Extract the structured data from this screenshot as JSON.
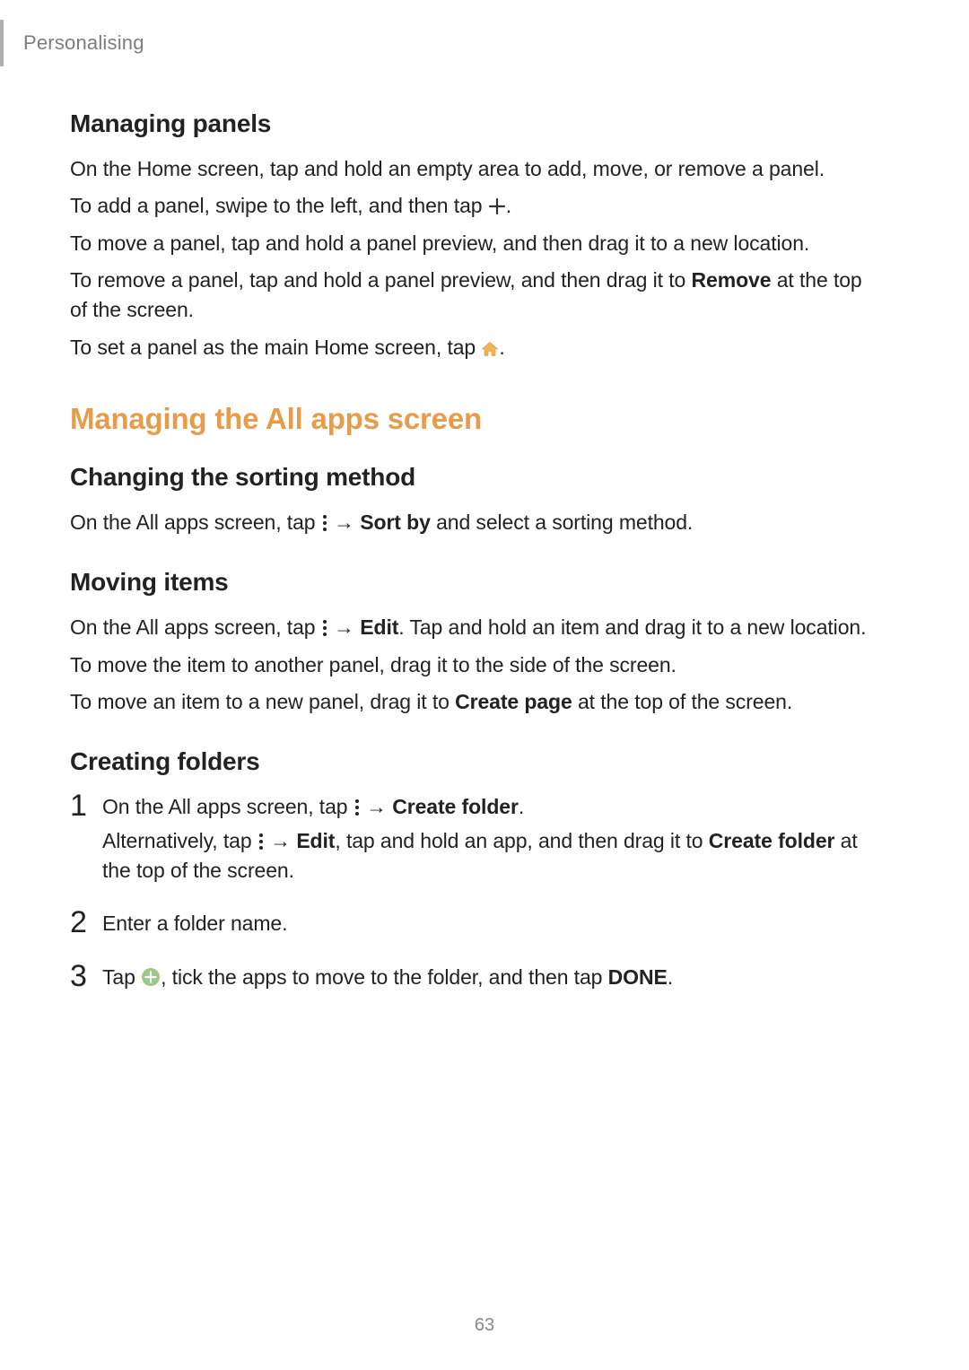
{
  "header": {
    "breadcrumb": "Personalising"
  },
  "s1": {
    "title": "Managing panels",
    "p1": "On the Home screen, tap and hold an empty area to add, move, or remove a panel.",
    "p2a": "To add a panel, swipe to the left, and then tap ",
    "p2b": ".",
    "p3": "To move a panel, tap and hold a panel preview, and then drag it to a new location.",
    "p4a": "To remove a panel, tap and hold a panel preview, and then drag it to ",
    "p4_bold": "Remove",
    "p4b": " at the top of the screen.",
    "p5a": "To set a panel as the main Home screen, tap ",
    "p5b": "."
  },
  "s2": {
    "title": "Managing the All apps screen",
    "sub1": {
      "title": "Changing the sorting method",
      "p1a": "On the All apps screen, tap ",
      "arrow": " → ",
      "p1_bold": "Sort by",
      "p1b": " and select a sorting method."
    },
    "sub2": {
      "title": "Moving items",
      "p1a": "On the All apps screen, tap ",
      "arrow": " → ",
      "p1_bold": "Edit",
      "p1b": ". Tap and hold an item and drag it to a new location.",
      "p2": "To move the item to another panel, drag it to the side of the screen.",
      "p3a": "To move an item to a new panel, drag it to ",
      "p3_bold": "Create page",
      "p3b": " at the top of the screen."
    },
    "sub3": {
      "title": "Creating folders",
      "step1": {
        "num": "1",
        "p1a": "On the All apps screen, tap ",
        "arrow": " → ",
        "p1_bold": "Create folder",
        "p1b": ".",
        "p2a": "Alternatively, tap ",
        "arrow2": " → ",
        "p2_bold1": "Edit",
        "p2mid": ", tap and hold an app, and then drag it to ",
        "p2_bold2": "Create folder",
        "p2b": " at the top of the screen."
      },
      "step2": {
        "num": "2",
        "p1": "Enter a folder name."
      },
      "step3": {
        "num": "3",
        "p1a": "Tap ",
        "p1b": ", tick the apps to move to the folder, and then tap ",
        "p1_bold": "DONE",
        "p1c": "."
      }
    }
  },
  "page_number": "63"
}
